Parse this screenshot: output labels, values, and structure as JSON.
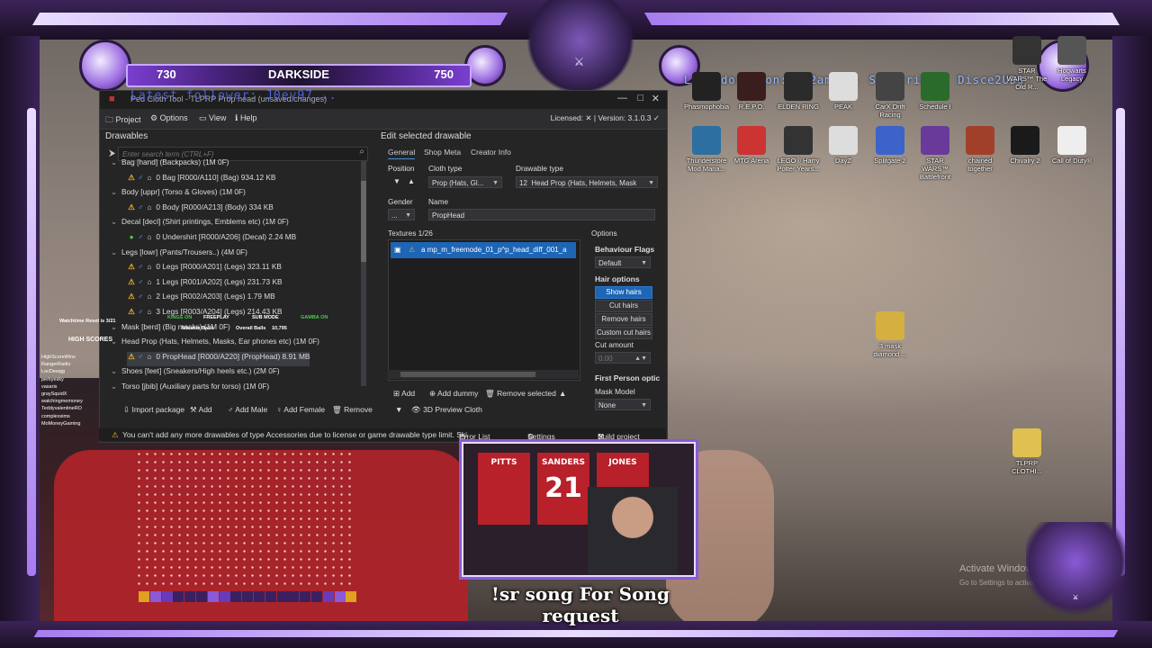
{
  "scoreboard": {
    "left_score": "730",
    "title": "DARKSIDE",
    "right_score": "750"
  },
  "overlay": {
    "top_text": "Last donation: DC2ams... Subscriber: Disce2UD3",
    "follower_text": "Latest follower: J0ey97...",
    "song_request": "!sr song For Song request",
    "activate_title": "Activate Windows",
    "activate_sub": "Go to Settings to activate Windows."
  },
  "window": {
    "title": "Ped Cloth Tool - TLPRP Prop head (unsaved changes)",
    "menu": {
      "project": "Project",
      "options": "Options",
      "view": "View",
      "help": "Help"
    },
    "license": "Licensed: ✕ | Version: 3.1.0.3 ✓",
    "drawables_title": "Drawables",
    "search_placeholder": "Enter search term (CTRL+F)",
    "tree": [
      {
        "type": "cat",
        "text": "Bag [hand] (Backpacks) (1M 0F)"
      },
      {
        "type": "item",
        "text": "0 Bag [R000/A110] (Bag) 934.12 KB"
      },
      {
        "type": "cat",
        "text": "Body [uppr] (Torso & Gloves) (1M 0F)"
      },
      {
        "type": "item",
        "text": "0 Body [R000/A213] (Body) 334 KB"
      },
      {
        "type": "cat",
        "text": "Decal [decl] (Shirt printings, Emblems etc) (1M 0F)"
      },
      {
        "type": "item",
        "text": "0 Undershirt [R000/A206] (Decal) 2.24 MB"
      },
      {
        "type": "cat",
        "text": "Legs [lowr] (Pants/Trousers..) (4M 0F)"
      },
      {
        "type": "item",
        "text": "0 Legs [R000/A201] (Legs) 323.11 KB"
      },
      {
        "type": "item",
        "text": "1 Legs [R001/A202] (Legs) 231.73 KB"
      },
      {
        "type": "item",
        "text": "2 Legs [R002/A203] (Legs) 1.79 MB"
      },
      {
        "type": "item",
        "text": "3 Legs [R003/A204] (Legs) 214.43 KB"
      },
      {
        "type": "cat",
        "text": "Mask [berd] (Big masks) (1M 0F)"
      },
      {
        "type": "cat",
        "text": "Head Prop (Hats, Helmets, Masks, Ear phones etc) (1M 0F)"
      },
      {
        "type": "item",
        "text": "0 PropHead [R000/A220] (PropHead) 8.91 MB"
      },
      {
        "type": "cat",
        "text": "Shoes [feet] (Sneakers/High heels etc.) (2M 0F)"
      },
      {
        "type": "cat",
        "text": "Torso [jbib] (Auxiliary parts for torso) (1M 0F)"
      }
    ],
    "left_toolbar": {
      "import": "Import package",
      "add": "Add",
      "add_male": "Add Male",
      "add_female": "Add Female",
      "remove": "Remove"
    },
    "edit_title": "Edit selected drawable",
    "tabs": {
      "general": "General",
      "shop_meta": "Shop Meta",
      "creator_info": "Creator Info"
    },
    "fields": {
      "position_label": "Position",
      "cloth_type_label": "Cloth type",
      "cloth_type_value": "Prop (Hats, Gl...",
      "drawable_type_label": "Drawable type",
      "drawable_type_num": "12",
      "drawable_type_value": "Head Prop (Hats, Helmets, Mask",
      "gender_label": "Gender",
      "gender_value": "...",
      "name_label": "Name",
      "name_value": "PropHead"
    },
    "textures_label": "Textures 1/26",
    "texture_item": "a  mp_m_freemode_01_p^p_head_diff_001_a",
    "right_bottom": {
      "add": "Add",
      "add_dummy": "Add dummy",
      "remove_selected": "Remove selected",
      "preview": "3D Preview Cloth"
    },
    "options": {
      "title": "Options",
      "behaviour_flags": "Behaviour Flags",
      "behaviour_value": "Default",
      "hair_options": "Hair options",
      "show_hairs": "Show hairs",
      "cut_hairs": "Cut hairs",
      "remove_hairs": "Remove hairs",
      "custom_cut_hairs": "Custom cut hairs",
      "cut_amount": "Cut amount",
      "cut_amount_value": "0.00",
      "first_person": "First Person optic",
      "mask_model": "Mask Model",
      "mask_model_value": "None"
    },
    "status": {
      "message": "You can't add any more drawables of type Accessories due to license or game drawable type limit. Ski",
      "error_list": "Error List",
      "settings": "Settings",
      "build": "Build project"
    }
  },
  "webcam": {
    "jersey1": "PITTS",
    "jersey2": "SANDERS",
    "jersey2_num": "21",
    "jersey3": "JONES"
  },
  "desktop_icons": [
    {
      "label": "Phasmophobia"
    },
    {
      "label": "R.E.P.O."
    },
    {
      "label": "ELDEN RING"
    },
    {
      "label": "PEAK"
    },
    {
      "label": "CarX Drift Racing"
    },
    {
      "label": "Schedule I"
    },
    {
      "label": "Thunderstore Mod Mana..."
    },
    {
      "label": "MTG Arena"
    },
    {
      "label": "LEGO® Harry Potter Years..."
    },
    {
      "label": "DayZ"
    },
    {
      "label": "Splitgate 2"
    },
    {
      "label": "STAR WARS™ Battlefront"
    },
    {
      "label": "chained together"
    },
    {
      "label": "Chivalry 2"
    },
    {
      "label": "Call of Duty®"
    },
    {
      "label": "3 mask diamond ..."
    },
    {
      "label": "TLPRP CLOTHI..."
    },
    {
      "label": "STAR WARS™ The Old R..."
    },
    {
      "label": "Hogwarts Legacy"
    }
  ],
  "stats": {
    "watchtime": "Watchtime Reset is 3/21",
    "high_scores": "HIGH SCORES",
    "bar": {
      "kings": "KINGS ON",
      "freeplay": "FREEPLAY",
      "sub_mode": "SUB MODE",
      "gamba": "GAMBA ON",
      "mission": "Mission Balls",
      "overall": "Overall Balls",
      "overall_val": "10,795"
    },
    "names": [
      "HighScoreWins",
      "RangerRadio",
      "LocDewgg",
      "perkyesky",
      "vasaris",
      "graySquidX",
      "watchingmemoney",
      "TeddyvalentineRO",
      "complexsims",
      "MoMoneyGaming"
    ]
  },
  "colors": {
    "accent": "#8a5ad8",
    "selection": "#1d65b5",
    "panel": "#252526"
  }
}
